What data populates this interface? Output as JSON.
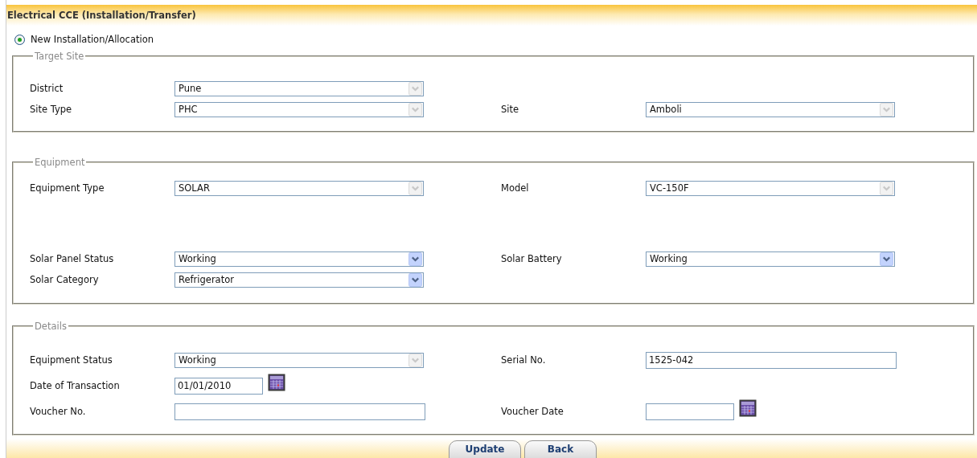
{
  "header": {
    "title": "Electrical CCE (Installation/Transfer)"
  },
  "mode": {
    "label": "New Installation/Allocation",
    "selected": true
  },
  "sections": [
    {
      "legend": "Target Site",
      "groups": [
        [
          {
            "left": {
              "label": "District",
              "kind": "select",
              "value": "Pune",
              "disabled": true
            }
          },
          {
            "left": {
              "label": "Site Type",
              "kind": "select",
              "value": "PHC",
              "disabled": true
            },
            "right": {
              "label": "Site",
              "kind": "select",
              "value": "Amboli",
              "disabled": true
            }
          }
        ]
      ]
    },
    {
      "legend": "Equipment",
      "groups": [
        [
          {
            "left": {
              "label": "Equipment Type",
              "kind": "select",
              "value": "SOLAR",
              "disabled": true
            },
            "right": {
              "label": "Model",
              "kind": "select",
              "value": "VC-150F",
              "disabled": true
            }
          }
        ],
        [
          {
            "left": {
              "label": "Solar Panel Status",
              "kind": "select",
              "value": "Working",
              "disabled": false
            },
            "right": {
              "label": "Solar Battery",
              "kind": "select",
              "value": "Working",
              "disabled": false
            }
          },
          {
            "left": {
              "label": "Solar Category",
              "kind": "select",
              "value": "Refrigerator",
              "disabled": false
            }
          }
        ]
      ]
    },
    {
      "legend": "Details",
      "groups": [
        [
          {
            "left": {
              "label": "Equipment Status",
              "kind": "select",
              "value": "Working",
              "disabled": true
            },
            "right": {
              "label": "Serial No.",
              "kind": "text",
              "value": "1525-042"
            }
          },
          {
            "left": {
              "label": "Date of Transaction",
              "kind": "date",
              "value": "01/01/2010"
            }
          },
          {
            "left": {
              "label": "Voucher No.",
              "kind": "text"
            },
            "right": {
              "label": "Voucher Date",
              "kind": "date"
            }
          }
        ]
      ]
    }
  ],
  "buttons": [
    "Update",
    "Back"
  ]
}
